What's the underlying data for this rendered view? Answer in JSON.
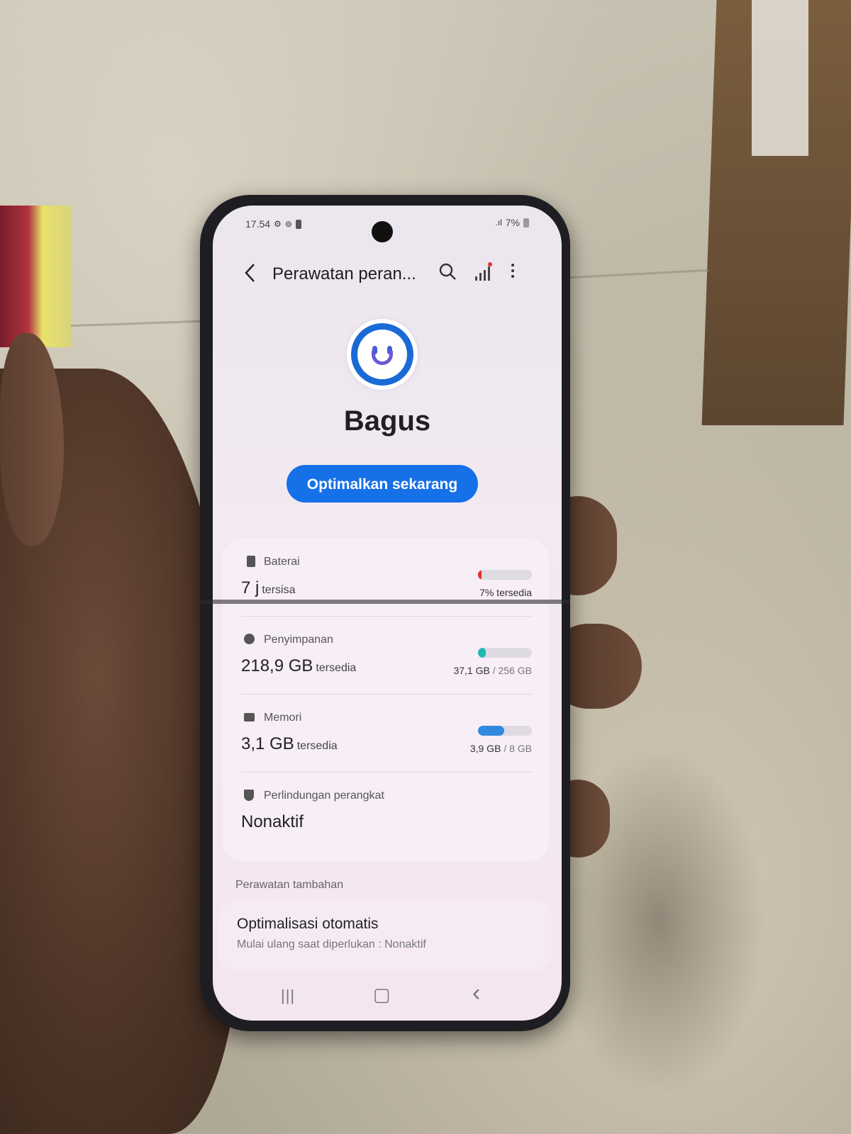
{
  "status_bar": {
    "time": "17.54",
    "signal": ".ıl",
    "battery_percent": "7%"
  },
  "header": {
    "title": "Perawatan peran...",
    "back_icon": "chevron-left-icon",
    "search_icon": "search-icon",
    "diagnostics_icon": "bar-chart-icon",
    "more_icon": "more-vert-icon"
  },
  "summary": {
    "status_word": "Bagus",
    "optimize_label": "Optimalkan sekarang"
  },
  "items": [
    {
      "label": "Baterai",
      "main": "7 j",
      "suffix": "tersisa",
      "detail": "7% tersedia",
      "detail_dim": "",
      "level": 0.07,
      "bar_color": "#e5322d"
    },
    {
      "label": "Penyimpanan",
      "main": "218,9 GB",
      "suffix": "tersedia",
      "detail": "37,1 GB",
      "detail_dim": "/ 256 GB",
      "level": 0.145,
      "bar_color": "#1fb7b0"
    },
    {
      "label": "Memori",
      "main": "3,1 GB",
      "suffix": "tersedia",
      "detail": "3,9 GB",
      "detail_dim": "/ 8 GB",
      "level": 0.49,
      "bar_color": "#2f8ae0"
    },
    {
      "label": "Perlindungan perangkat",
      "main": "Nonaktif",
      "suffix": "",
      "detail": "",
      "detail_dim": ""
    }
  ],
  "extra": {
    "section_title": "Perawatan tambahan",
    "auto_title": "Optimalisasi otomatis",
    "auto_sub": "Mulai ulang saat diperlukan : Nonaktif"
  },
  "nav": {
    "recents": "|||",
    "home": "▢",
    "back": "‹"
  }
}
